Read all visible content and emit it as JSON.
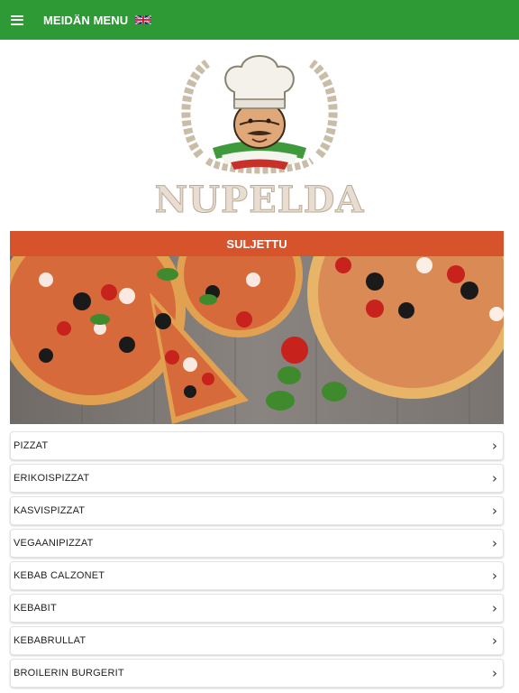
{
  "header": {
    "title": "MEIDÄN MENU",
    "menu_icon": "hamburger-menu-icon",
    "language_icon": "uk-flag-icon",
    "background_color": "#2e9a36"
  },
  "brand": {
    "name": "NUPELDA",
    "logo_icon": "chef-mascot-logo"
  },
  "status": {
    "label": "SULJETTU",
    "color": "#d6532c"
  },
  "hero": {
    "image": "pizza-banner-image"
  },
  "menu": {
    "chevron_icon": "chevron-right-icon",
    "items": [
      {
        "label": "PIZZAT"
      },
      {
        "label": "ERIKOISPIZZAT"
      },
      {
        "label": "KASVISPIZZAT"
      },
      {
        "label": "VEGAANIPIZZAT"
      },
      {
        "label": "KEBAB CALZONET"
      },
      {
        "label": "KEBABIT"
      },
      {
        "label": "KEBABRULLAT"
      },
      {
        "label": "BROILERIN BURGERIT"
      }
    ]
  }
}
